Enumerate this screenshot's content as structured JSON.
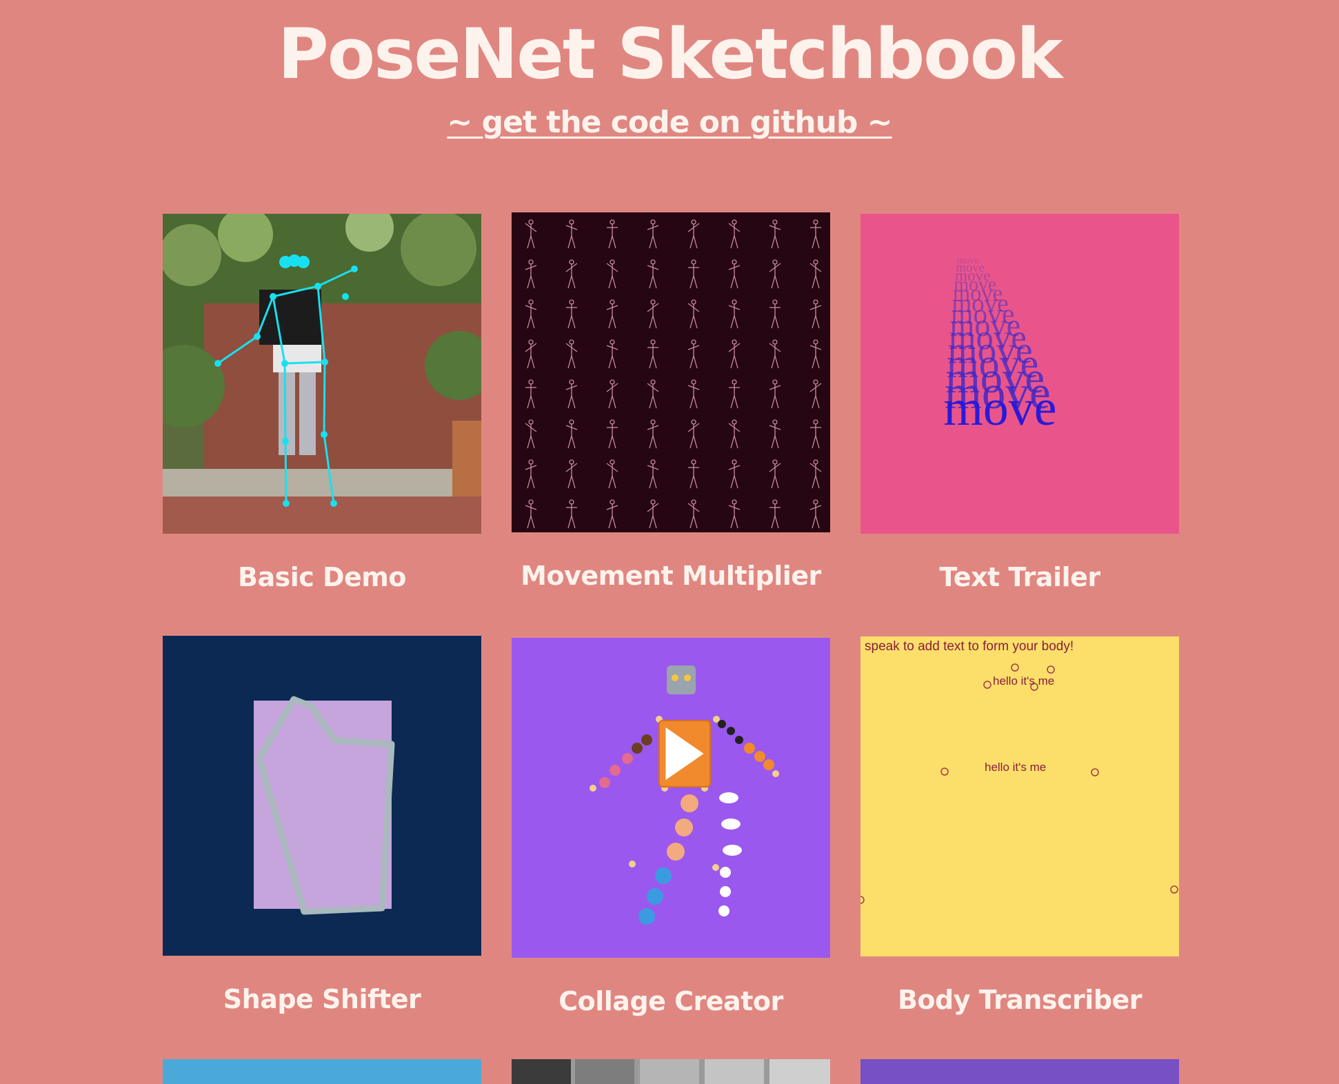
{
  "header": {
    "title": "PoseNet Sketchbook",
    "github_link": "~ get the code on github ~"
  },
  "projects": [
    {
      "label": "Basic Demo"
    },
    {
      "label": "Movement Multiplier"
    },
    {
      "label": "Text Trailer",
      "thumb_text": "move"
    },
    {
      "label": "Shape Shifter"
    },
    {
      "label": "Collage Creator"
    },
    {
      "label": "Body Transcriber",
      "thumb_prompt": "speak to add text to form your body!",
      "thumb_words": [
        "hello it's me",
        "hello it's me"
      ]
    }
  ],
  "colors": {
    "background": "#e08681",
    "text": "#fdf3ec",
    "movement_bg": "#250612",
    "text_trailer_bg": "#e9558a",
    "shape_shifter_bg": "#0b2952",
    "collage_bg": "#9b58ee",
    "transcriber_bg": "#fbdf6a"
  }
}
